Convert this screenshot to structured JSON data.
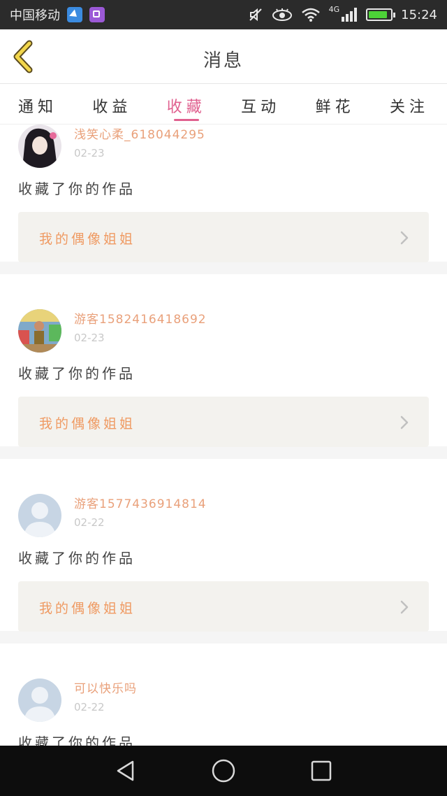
{
  "status_bar": {
    "carrier": "中国移动",
    "network": "4G",
    "time": "15:24",
    "battery_level": 0.85,
    "battery_color": "#4cd137"
  },
  "header": {
    "title": "消息",
    "back_icon": "chevron-left-icon"
  },
  "tabs": [
    {
      "label": "通知",
      "active": false
    },
    {
      "label": "收益",
      "active": false
    },
    {
      "label": "收藏",
      "active": true
    },
    {
      "label": "互动",
      "active": false
    },
    {
      "label": "鲜花",
      "active": false
    },
    {
      "label": "关注",
      "active": false
    }
  ],
  "accent_color": "#e0608f",
  "items": [
    {
      "username": "浅笑心柔_618044295",
      "date": "02-23",
      "action": "收藏了你的作品",
      "work_title": "我的偶像姐姐",
      "avatar": "photo-girl"
    },
    {
      "username": "游客1582416418692",
      "date": "02-23",
      "action": "收藏了你的作品",
      "work_title": "我的偶像姐姐",
      "avatar": "photo-child"
    },
    {
      "username": "游客1577436914814",
      "date": "02-22",
      "action": "收藏了你的作品",
      "work_title": "我的偶像姐姐",
      "avatar": "default-avatar"
    },
    {
      "username": "可以快乐吗",
      "date": "02-22",
      "action": "收藏了你的作品",
      "work_title": "",
      "avatar": "default-avatar"
    }
  ],
  "nav_bar": {
    "buttons": [
      "back-triangle-icon",
      "home-circle-icon",
      "recents-square-icon"
    ]
  }
}
